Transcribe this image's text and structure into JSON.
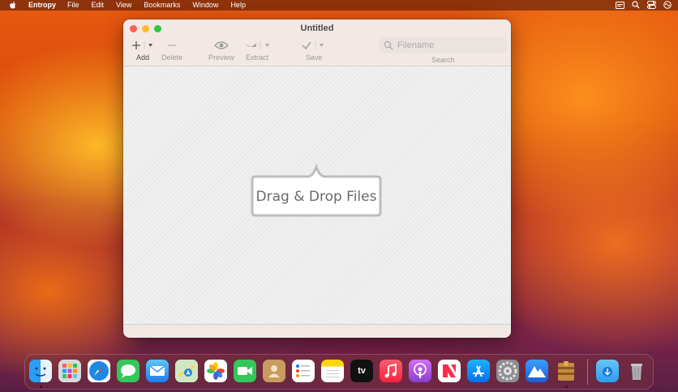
{
  "menubar": {
    "app_name": "Entropy",
    "items": [
      "File",
      "Edit",
      "View",
      "Bookmarks",
      "Window",
      "Help"
    ]
  },
  "window": {
    "title": "Untitled",
    "toolbar": {
      "add_label": "Add",
      "delete_label": "Delete",
      "preview_label": "Preview",
      "extract_label": "Extract",
      "save_label": "Save",
      "search_label": "Search",
      "search_placeholder": "Filename"
    },
    "drop_zone_text": "Drag & Drop Files"
  },
  "dock": {
    "apps": [
      "Finder",
      "Launchpad",
      "Safari",
      "Messages",
      "Mail",
      "Maps",
      "Photos",
      "FaceTime",
      "Contacts",
      "Reminders",
      "Notes",
      "TV",
      "Music",
      "Podcasts",
      "News",
      "App Store",
      "System Preferences",
      "Altitude",
      "Entropy",
      "Downloads",
      "Trash"
    ],
    "tv_glyph": "tv"
  },
  "colors": {
    "close": "#ff5f57",
    "minimize": "#febc2e",
    "maximize": "#28c840"
  }
}
